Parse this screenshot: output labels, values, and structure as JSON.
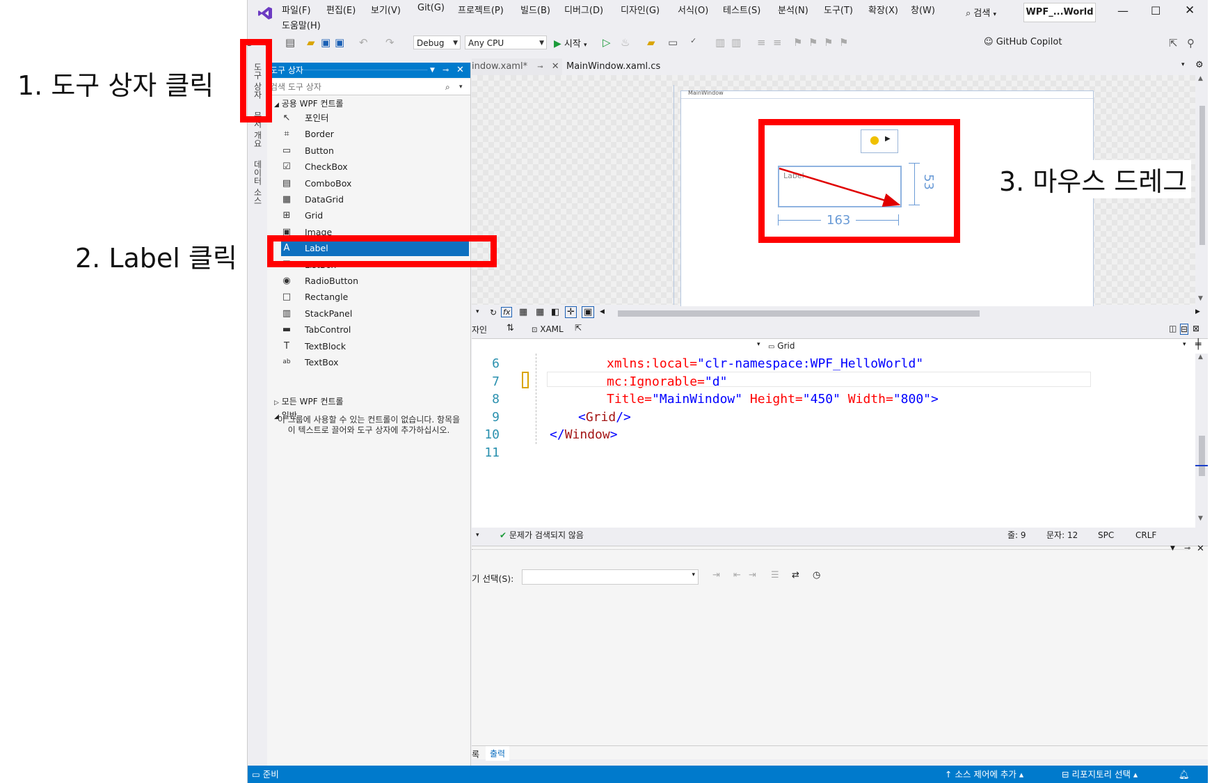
{
  "annotations": {
    "step1": "1. 도구 상자 클릭",
    "step2": "2. Label 클릭",
    "step3": "3. 마우스 드레그"
  },
  "menu": {
    "items": [
      "파일(F)",
      "편집(E)",
      "보기(V)",
      "Git(G)",
      "프로젝트(P)",
      "빌드(B)",
      "디버그(D)",
      "디자인(G)",
      "서식(O)",
      "테스트(S)",
      "분석(N)",
      "도구(T)",
      "확장(X)",
      "창(W)"
    ],
    "help": "도움말(H)",
    "search": "검색",
    "solution": "WPF_...World"
  },
  "toolbar": {
    "config": "Debug",
    "platform": "Any CPU",
    "start": "시작",
    "copilot": "GitHub Copilot"
  },
  "side_tabs": [
    "도구 상자",
    "문서 개요",
    "데이터 소스"
  ],
  "toolbox": {
    "title": "도구 상자",
    "search_placeholder": "검색 도구 상자",
    "group_common": "공용 WPF 컨트롤",
    "items": [
      {
        "label": "포인터",
        "icon": "pointer-icon",
        "glyph": "↖"
      },
      {
        "label": "Border",
        "icon": "border-icon",
        "glyph": "⌗"
      },
      {
        "label": "Button",
        "icon": "button-icon",
        "glyph": "▭"
      },
      {
        "label": "CheckBox",
        "icon": "checkbox-icon",
        "glyph": "☑"
      },
      {
        "label": "ComboBox",
        "icon": "combobox-icon",
        "glyph": "▤"
      },
      {
        "label": "DataGrid",
        "icon": "datagrid-icon",
        "glyph": "▦"
      },
      {
        "label": "Grid",
        "icon": "grid-icon",
        "glyph": "⊞"
      },
      {
        "label": "Image",
        "icon": "image-icon",
        "glyph": "▣"
      },
      {
        "label": "Label",
        "icon": "label-icon",
        "glyph": "A"
      },
      {
        "label": "ListBox",
        "icon": "listbox-icon",
        "glyph": "☰"
      },
      {
        "label": "RadioButton",
        "icon": "radiobutton-icon",
        "glyph": "◉"
      },
      {
        "label": "Rectangle",
        "icon": "rectangle-icon",
        "glyph": "□"
      },
      {
        "label": "StackPanel",
        "icon": "stackpanel-icon",
        "glyph": "▥"
      },
      {
        "label": "TabControl",
        "icon": "tabcontrol-icon",
        "glyph": "▬"
      },
      {
        "label": "TextBlock",
        "icon": "textblock-icon",
        "glyph": "T"
      },
      {
        "label": "TextBox",
        "icon": "textbox-icon",
        "glyph": "ab"
      }
    ],
    "selected_item": "Label",
    "group_all": "모든 WPF 컨트롤",
    "group_general": "일반",
    "empty_note": "이 그룹에 사용할 수 있는 컨트롤이 없습니다. 항목을 이 텍스트로 끌어와 도구 상자에 추가하십시오."
  },
  "doc_tabs": {
    "tab1": "indow.xaml*",
    "tab2": "MainWindow.xaml.cs"
  },
  "designer": {
    "window_title": "MainWindow",
    "label_text": "Label",
    "width_value": "163",
    "height_value": "53"
  },
  "xaml_bar": {
    "design_tab": "자인",
    "xaml_tab": "XAML",
    "element_combo": "Grid"
  },
  "code": {
    "lines": [
      {
        "num": "6",
        "indent": 10,
        "parts": [
          [
            "attr",
            "xmlns:local="
          ],
          [
            "val",
            "\"clr-namespace:WPF_HelloWorld\""
          ]
        ]
      },
      {
        "num": "7",
        "indent": 10,
        "parts": [
          [
            "attr",
            "mc:Ignorable="
          ],
          [
            "val",
            "\"d\""
          ]
        ]
      },
      {
        "num": "8",
        "indent": 10,
        "parts": [
          [
            "attr",
            "Title="
          ],
          [
            "val",
            "\"MainWindow\""
          ],
          [
            "attr",
            " Height="
          ],
          [
            "val",
            "\"450\""
          ],
          [
            "attr",
            " Width="
          ],
          [
            "val",
            "\"800\""
          ],
          [
            "bl",
            ">"
          ]
        ]
      },
      {
        "num": "9",
        "indent": 5,
        "parts": [
          [
            "bl",
            "<"
          ],
          [
            "tag",
            "Grid"
          ],
          [
            "bl",
            "/>"
          ]
        ]
      },
      {
        "num": "10",
        "indent": 0,
        "parts": [
          [
            "bl",
            "</"
          ],
          [
            "tag",
            "Window"
          ],
          [
            "bl",
            ">"
          ]
        ]
      },
      {
        "num": "11",
        "indent": 0,
        "parts": []
      }
    ]
  },
  "editor_status": {
    "issues": "문제가 검색되지 않음",
    "line": "줄: 9",
    "col": "문자: 12",
    "spc": "SPC",
    "crlf": "CRLF"
  },
  "output_panel": {
    "source_label": "기 선택(S):",
    "tab1": "록",
    "tab2": "출력"
  },
  "statusbar": {
    "ready": "준비",
    "source_control": "소스 제어에 추가",
    "repository": "리포지토리 선택"
  },
  "colors": {
    "accent": "#007acc",
    "annotation_red": "#ff0000",
    "selection": "#0e70c0"
  }
}
